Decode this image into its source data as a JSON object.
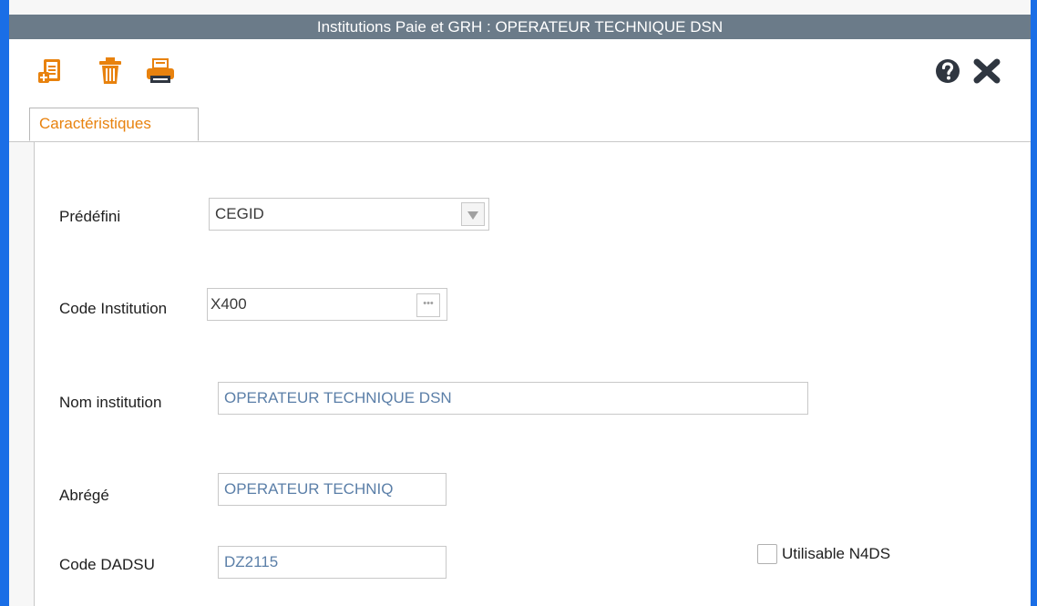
{
  "window": {
    "title": "Institutions Paie et GRH :  OPERATEUR TECHNIQUE DSN"
  },
  "toolbar": {
    "icons": [
      "new-document-icon",
      "delete-trash-icon",
      "print-icon",
      "help-icon",
      "close-icon"
    ]
  },
  "tabs": [
    {
      "label": "Caractéristiques",
      "active": true
    }
  ],
  "form": {
    "predefini": {
      "label": "Prédéfini",
      "value": "CEGID"
    },
    "code_institution": {
      "label": "Code Institution",
      "value": "X400"
    },
    "nom_institution": {
      "label": "Nom institution",
      "value": "OPERATEUR TECHNIQUE DSN"
    },
    "abrege": {
      "label": "Abrégé",
      "value": "OPERATEUR TECHNIQ"
    },
    "code_dadsu": {
      "label": "Code DADSU",
      "value": "DZ2115"
    },
    "utilisable_n4ds": {
      "label": "Utilisable N4DS",
      "checked": false
    }
  },
  "colors": {
    "title_bar": "#6b7b89",
    "window_border": "#1a6ee6",
    "tab_text": "#e8820e",
    "field_text_blue": "#5b7fa8",
    "icon_orange": "#e8820e",
    "icon_dark": "#2f3640"
  }
}
